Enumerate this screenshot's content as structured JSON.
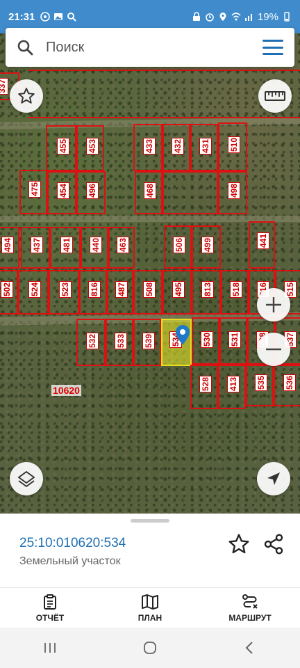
{
  "status_bar": {
    "time": "21:31",
    "battery": "19%"
  },
  "search": {
    "placeholder": "Поиск"
  },
  "map": {
    "area_label": "10620",
    "plots": [
      {
        "label": "455"
      },
      {
        "label": "453"
      },
      {
        "label": "433"
      },
      {
        "label": "432"
      },
      {
        "label": "431"
      },
      {
        "label": "510"
      },
      {
        "label": "475"
      },
      {
        "label": "454"
      },
      {
        "label": "496"
      },
      {
        "label": "468"
      },
      {
        "label": "498"
      },
      {
        "label": "494"
      },
      {
        "label": "437"
      },
      {
        "label": "481"
      },
      {
        "label": "440"
      },
      {
        "label": "463"
      },
      {
        "label": "506"
      },
      {
        "label": "499"
      },
      {
        "label": "441"
      },
      {
        "label": "502"
      },
      {
        "label": "524"
      },
      {
        "label": "523"
      },
      {
        "label": "816"
      },
      {
        "label": "487"
      },
      {
        "label": "508"
      },
      {
        "label": "495"
      },
      {
        "label": "813"
      },
      {
        "label": "518"
      },
      {
        "label": "516"
      },
      {
        "label": "515"
      },
      {
        "label": "532"
      },
      {
        "label": "533"
      },
      {
        "label": "539"
      },
      {
        "label": "534"
      },
      {
        "label": "530"
      },
      {
        "label": "531"
      },
      {
        "label": "538"
      },
      {
        "label": "537"
      },
      {
        "label": "528"
      },
      {
        "label": "413"
      },
      {
        "label": "535"
      },
      {
        "label": "536"
      },
      {
        "label": "337"
      }
    ]
  },
  "sheet": {
    "cadastral_number": "25:10:010620:534",
    "object_type": "Земельный участок"
  },
  "tabs": [
    {
      "label": "ОТЧЁТ"
    },
    {
      "label": "ПЛАН"
    },
    {
      "label": "МАРШРУТ"
    }
  ]
}
